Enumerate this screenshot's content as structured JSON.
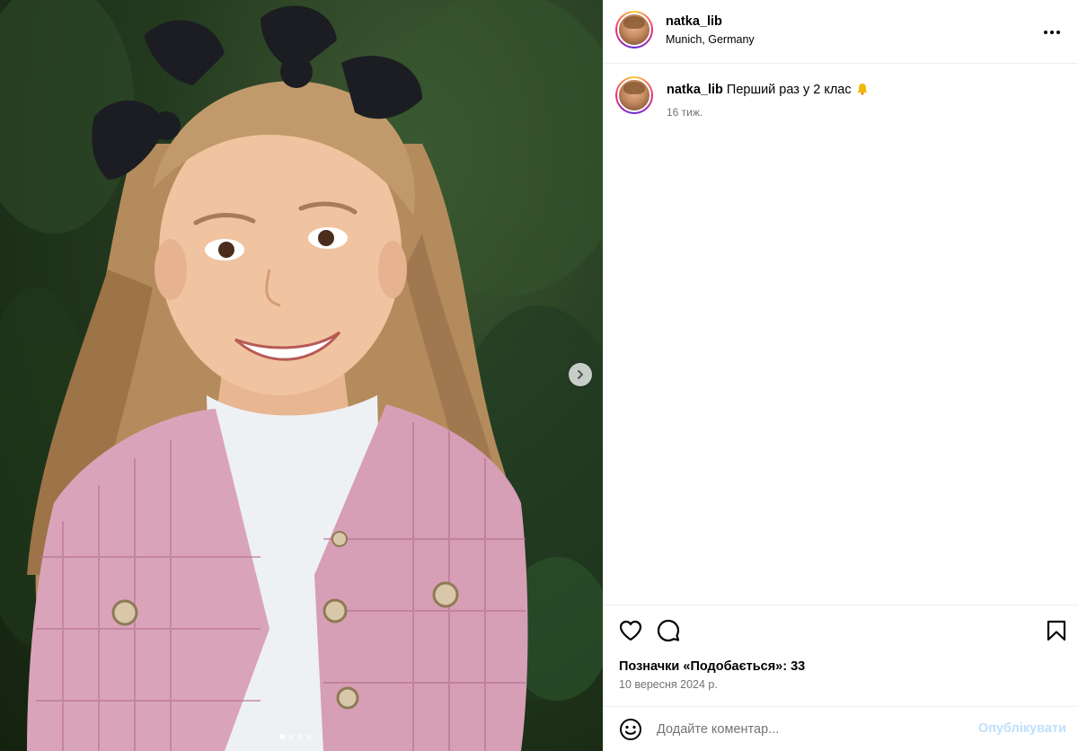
{
  "post": {
    "username": "natka_lib",
    "location": "Munich, Germany",
    "more_icon": "more-horizontal-icon"
  },
  "caption": {
    "username": "natka_lib",
    "text": "Перший раз у 2 клас",
    "emoji": "bell-emoji",
    "time": "16 тиж."
  },
  "media": {
    "carousel_total": 4,
    "carousel_current": 1,
    "next_icon": "chevron-right-icon"
  },
  "actions": {
    "like_icon": "heart-icon",
    "comment_icon": "comment-icon",
    "save_icon": "bookmark-icon",
    "likes_text": "Позначки «Подобається»: 33",
    "date": "10 вересня 2024 р."
  },
  "comment": {
    "emoji_icon": "smiley-icon",
    "placeholder": "Додайте коментар...",
    "publish_label": "Опублікувати",
    "publish_color": "#bfe0fd"
  },
  "colors": {
    "secondary_text": "#737373",
    "divider": "#efefef"
  }
}
